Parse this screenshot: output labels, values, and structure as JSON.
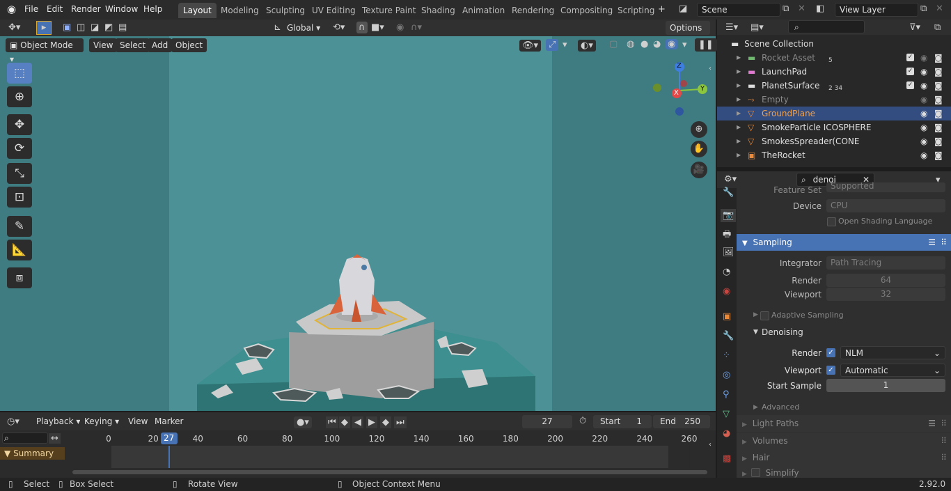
{
  "menu": [
    "File",
    "Edit",
    "Render",
    "Window",
    "Help"
  ],
  "workspaces": [
    "Layout",
    "Modeling",
    "Sculpting",
    "UV Editing",
    "Texture Paint",
    "Shading",
    "Animation",
    "Rendering",
    "Compositing",
    "Scripting"
  ],
  "scene": {
    "name": "Scene",
    "view_layer": "View Layer"
  },
  "header3d": {
    "orientation": "Global",
    "options": "Options",
    "mode": "Object Mode",
    "view": "View",
    "select": "Select",
    "add": "Add",
    "object": "Object"
  },
  "outliner": {
    "root": "Scene Collection",
    "items": [
      {
        "name": "Rocket Asset",
        "badge": "5",
        "muted": true
      },
      {
        "name": "LaunchPad",
        "badge": "",
        "muted": false
      },
      {
        "name": "PlanetSurface",
        "badge": "2   34",
        "muted": false
      },
      {
        "name": "Empty",
        "badge": "",
        "muted": true
      },
      {
        "name": "GroundPlane",
        "badge": "",
        "muted": false,
        "selected": true
      },
      {
        "name": "SmokeParticle ICOSPHERE",
        "badge": "",
        "muted": false
      },
      {
        "name": "SmokesSpreader(CONE",
        "badge": "",
        "muted": false
      },
      {
        "name": "TheRocket",
        "badge": "",
        "muted": false
      }
    ]
  },
  "properties": {
    "search": "denoi",
    "feature_set": {
      "label": "Feature Set",
      "value": "Supported"
    },
    "device": {
      "label": "Device",
      "value": "CPU"
    },
    "osl": "Open Shading Language",
    "sampling": "Sampling",
    "integrator": {
      "label": "Integrator",
      "value": "Path Tracing"
    },
    "render": {
      "label": "Render",
      "value": "64"
    },
    "viewport": {
      "label": "Viewport",
      "value": "32"
    },
    "adaptive": "Adaptive Sampling",
    "denoising": "Denoising",
    "den_render": {
      "label": "Render",
      "value": "NLM"
    },
    "den_viewport": {
      "label": "Viewport",
      "value": "Automatic"
    },
    "start_sample": {
      "label": "Start Sample",
      "value": "1"
    },
    "advanced": "Advanced",
    "light_paths": "Light Paths",
    "volumes": "Volumes",
    "hair": "Hair",
    "simplify": "Simplify"
  },
  "timeline": {
    "playback": "Playback",
    "keying": "Keying",
    "view": "View",
    "marker": "Marker",
    "current_frame": "27",
    "start_label": "Start",
    "start": "1",
    "end_label": "End",
    "end": "250",
    "summary": "Summary",
    "ticks": [
      "0",
      "20",
      "40",
      "60",
      "80",
      "100",
      "120",
      "140",
      "160",
      "180",
      "200",
      "220",
      "240",
      "260"
    ],
    "ticks_value": [
      0,
      20,
      40,
      60,
      80,
      100,
      120,
      140,
      160,
      180,
      200,
      220,
      240,
      260
    ],
    "playhead": "27"
  },
  "status": {
    "select": "Select",
    "box_select": "Box Select",
    "rotate": "Rotate View",
    "context": "Object Context Menu",
    "version": "2.92.0"
  },
  "gizmo": {
    "z": "Z",
    "x": "X",
    "y": "Y"
  },
  "colors": {
    "accent": "#4772b3",
    "viewport": "#4c9196",
    "selected_row": "#334d80",
    "orange": "#e8893a"
  }
}
